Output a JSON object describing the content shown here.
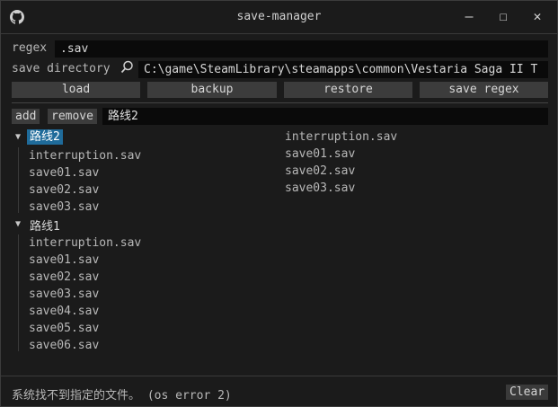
{
  "window": {
    "title": "save-manager",
    "minimize": "—",
    "maximize": "☐",
    "close": "✕"
  },
  "form": {
    "regex_label": "regex",
    "regex_value": ".sav",
    "dir_label": "save directory",
    "dir_value": "C:\\game\\SteamLibrary\\steamapps\\common\\Vestaria Saga II T"
  },
  "actions": {
    "load": "load",
    "backup": "backup",
    "restore": "restore",
    "save_regex": "save regex"
  },
  "profiles": {
    "add": "add",
    "remove": "remove",
    "name_value": "路线2"
  },
  "tree": [
    {
      "name": "路线2",
      "files": [
        "interruption.sav",
        "save01.sav",
        "save02.sav",
        "save03.sav"
      ]
    },
    {
      "name": "路线1",
      "files": [
        "interruption.sav",
        "save01.sav",
        "save02.sav",
        "save03.sav",
        "save04.sav",
        "save05.sav",
        "save06.sav"
      ]
    }
  ],
  "right_files": [
    "interruption.sav",
    "save01.sav",
    "save02.sav",
    "save03.sav"
  ],
  "status": {
    "message": "系统找不到指定的文件。 (os error 2)",
    "clear": "Clear"
  },
  "colors": {
    "selection": "#1f6b9a",
    "background": "#1b1b1b",
    "button": "#3c3c3c",
    "field": "#0a0a0a"
  }
}
